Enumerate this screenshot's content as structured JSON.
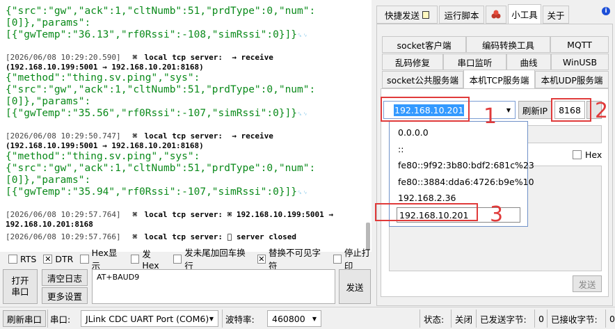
{
  "log": {
    "lines": [
      {
        "kind": "json",
        "text": "{\"src\":\"gw\",\"ack\":1,\"cltNumb\":51,\"prdType\":0,\"num\":"
      },
      {
        "kind": "json",
        "text": "[0]},\"params\":"
      },
      {
        "kind": "json",
        "text": "[{\"gwTemp\":\"36.13\",\"rf0Rssi\":-108,\"simRssi\":0}]}",
        "crlf": "␍␊"
      },
      {
        "kind": "blank"
      },
      {
        "kind": "meta",
        "ts": "[2026/06/08 10:29:20.590]",
        "icon": "⌘",
        "text": "local tcp server:  → receive"
      },
      {
        "kind": "addr",
        "text": "(192.168.10.199:5001 → 192.168.10.201:8168)"
      },
      {
        "kind": "json",
        "text": "{\"method\":\"thing.sv.ping\",\"sys\":"
      },
      {
        "kind": "json",
        "text": "{\"src\":\"gw\",\"ack\":1,\"cltNumb\":51,\"prdType\":0,\"num\":"
      },
      {
        "kind": "json",
        "text": "[0]},\"params\":"
      },
      {
        "kind": "json",
        "text": "[{\"gwTemp\":\"35.56\",\"rf0Rssi\":-107,\"simRssi\":0}]}",
        "crlf": "␍␊"
      },
      {
        "kind": "blank"
      },
      {
        "kind": "meta",
        "ts": "[2026/06/08 10:29:50.747]",
        "icon": "⌘",
        "text": "local tcp server:  → receive"
      },
      {
        "kind": "addr",
        "text": "(192.168.10.199:5001 → 192.168.10.201:8168)"
      },
      {
        "kind": "json",
        "text": "{\"method\":\"thing.sv.ping\",\"sys\":"
      },
      {
        "kind": "json",
        "text": "{\"src\":\"gw\",\"ack\":1,\"cltNumb\":51,\"prdType\":0,\"num\":"
      },
      {
        "kind": "json",
        "text": "[0]},\"params\":"
      },
      {
        "kind": "json",
        "text": "[{\"gwTemp\":\"35.94\",\"rf0Rssi\":-107,\"simRssi\":0}]}",
        "crlf": "␍␊"
      },
      {
        "kind": "blank"
      },
      {
        "kind": "meta",
        "ts": "[2026/06/08 10:29:57.764]",
        "icon": "⌘",
        "text": "local tcp server: ⌘ 192.168.10.199:5001 →"
      },
      {
        "kind": "addr",
        "text": "192.168.10.201:8168"
      },
      {
        "kind": "meta",
        "ts": "[2026/06/08 10:29:57.766]",
        "icon": "⌘",
        "text": "local tcp server: ⃠ server closed"
      }
    ]
  },
  "options": [
    {
      "label": "RTS",
      "checked": false
    },
    {
      "label": "DTR",
      "checked": true
    },
    {
      "label": "Hex显示",
      "checked": false
    },
    {
      "label": "发Hex",
      "checked": false
    },
    {
      "label": "发未尾加回车换行",
      "checked": false
    },
    {
      "label": "替换不可见字符",
      "checked": true
    },
    {
      "label": "停止打印",
      "checked": false
    }
  ],
  "buttons": {
    "open_port": "打开\n串口",
    "clear_log": "清空日志",
    "more_settings": "更多设置",
    "send": "发送",
    "send_input": "AT+BAUD9"
  },
  "top_tabs": [
    {
      "label": "快捷发送",
      "icon": "note-icon"
    },
    {
      "label": "运行脚本"
    },
    {
      "label": "",
      "icon": "cube-icon"
    },
    {
      "label": "小工具",
      "selected": true
    },
    {
      "label": "关于"
    }
  ],
  "tool_tabs": {
    "row1": [
      "socket客户端",
      "编码转换工具",
      "MQTT"
    ],
    "row2": [
      "乱码修复",
      "串口监听",
      "曲线",
      "WinUSB"
    ],
    "row3": [
      "socket公共服务端",
      "本机TCP服务端",
      "本机UDP服务端"
    ]
  },
  "server": {
    "ip_value": "192.168.10.201",
    "refresh_ip": "刷新IP",
    "port": "8168",
    "hex_label": "Hex",
    "send": "发送",
    "ip_options": [
      "0.0.0.0",
      "::",
      "fe80::9f92:3b80:bdf2:681c%23",
      "fe80::3884:dda6:4726:b9e%10",
      "192.168.2.36",
      "192.168.10.201"
    ]
  },
  "annotations": {
    "n1": "1",
    "n2": "2",
    "n3": "3"
  },
  "statusbar": {
    "refresh_port": "刷新串口",
    "port_label": "串口:",
    "port_value": "JLink CDC UART Port (COM6)",
    "baud_label": "波特率:",
    "baud_value": "460800",
    "state_label": "状态:",
    "state_value": "关闭",
    "sent_label": "已发送字节:",
    "sent_value": "0",
    "recv_label": "已接收字节:",
    "recv_value": "0"
  },
  "colors": {
    "json_green": "#0a8a1a",
    "annotation_red": "#e03a3a",
    "selection_blue": "#3399ff"
  }
}
